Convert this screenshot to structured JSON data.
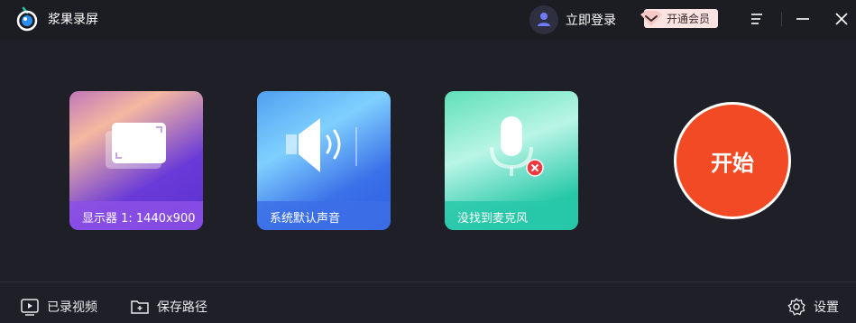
{
  "app": {
    "title": "浆果录屏"
  },
  "header": {
    "login_label": "立即登录",
    "vip_label": "开通会员",
    "icons": [
      "user-icon",
      "diamond-icon",
      "menu-icon",
      "minimize-icon",
      "close-icon"
    ]
  },
  "cards": {
    "display": {
      "label": "显示器 1: 1440x900",
      "icon": "screen-icon"
    },
    "audio": {
      "label": "系统默认声音",
      "icon": "speaker-icon"
    },
    "mic": {
      "label": "没找到麦克风",
      "icon": "microphone-icon",
      "status_icon": "error-icon"
    }
  },
  "start": {
    "label": "开始"
  },
  "footer": {
    "videos_label": "已录视频",
    "save_path_label": "保存路径",
    "settings_label": "设置"
  },
  "colors": {
    "background": "#1f2027",
    "start_button": "#f24a25",
    "vip_badge": "#fbe3e1"
  }
}
